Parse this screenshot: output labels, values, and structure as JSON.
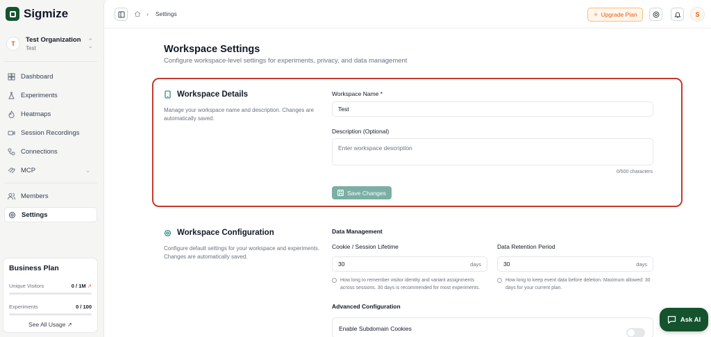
{
  "brand": {
    "name": "Sigmize"
  },
  "org": {
    "initial": "T",
    "name": "Test Organization",
    "sub": "Test"
  },
  "nav": {
    "items": [
      {
        "label": "Dashboard"
      },
      {
        "label": "Experiments"
      },
      {
        "label": "Heatmaps"
      },
      {
        "label": "Session Recordings"
      },
      {
        "label": "Connections"
      },
      {
        "label": "MCP"
      },
      {
        "label": "Members"
      },
      {
        "label": "Settings"
      }
    ]
  },
  "plan": {
    "title": "Business Plan",
    "rows": [
      {
        "label": "Unique Visitors",
        "value": "0 / 1M",
        "fill": 0
      },
      {
        "label": "Experiments",
        "value": "0 / 100",
        "fill": 0
      }
    ],
    "link": "See All Usage ↗"
  },
  "topbar": {
    "crumb": "Settings",
    "upgrade": "Upgrade Plan",
    "user_initial": "S"
  },
  "page": {
    "title": "Workspace Settings",
    "subtitle": "Configure workspace-level settings for experiments, privacy, and data management"
  },
  "details": {
    "title": "Workspace Details",
    "desc": "Manage your workspace name and description. Changes are automatically saved.",
    "name_label": "Workspace Name *",
    "name_value": "Test",
    "desc_label": "Description (Optional)",
    "desc_placeholder": "Enter workspace description",
    "counter": "0/500 characters",
    "save": "Save Changes"
  },
  "config": {
    "title": "Workspace Configuration",
    "desc": "Configure default settings for your workspace and experiments. Changes are automatically saved.",
    "data_mgmt": "Data Management",
    "cookie_label": "Cookie / Session Lifetime",
    "cookie_value": "30",
    "cookie_suffix": "days",
    "cookie_hint": "How long to remember visitor identity and variant assignments across sessions. 30 days is recommended for most experiments.",
    "retention_label": "Data Retention Period",
    "retention_value": "30",
    "retention_suffix": "days",
    "retention_hint": "How long to keep event data before deletion. Maximum allowed: 30 days for your current plan.",
    "advanced": "Advanced Configuration",
    "subdomain": "Enable Subdomain Cookies"
  },
  "ask_ai": "Ask AI",
  "colors": {
    "brand": "#14532d",
    "accent": "#ea580c",
    "save": "#7bafa4",
    "highlight": "#c0392b"
  }
}
